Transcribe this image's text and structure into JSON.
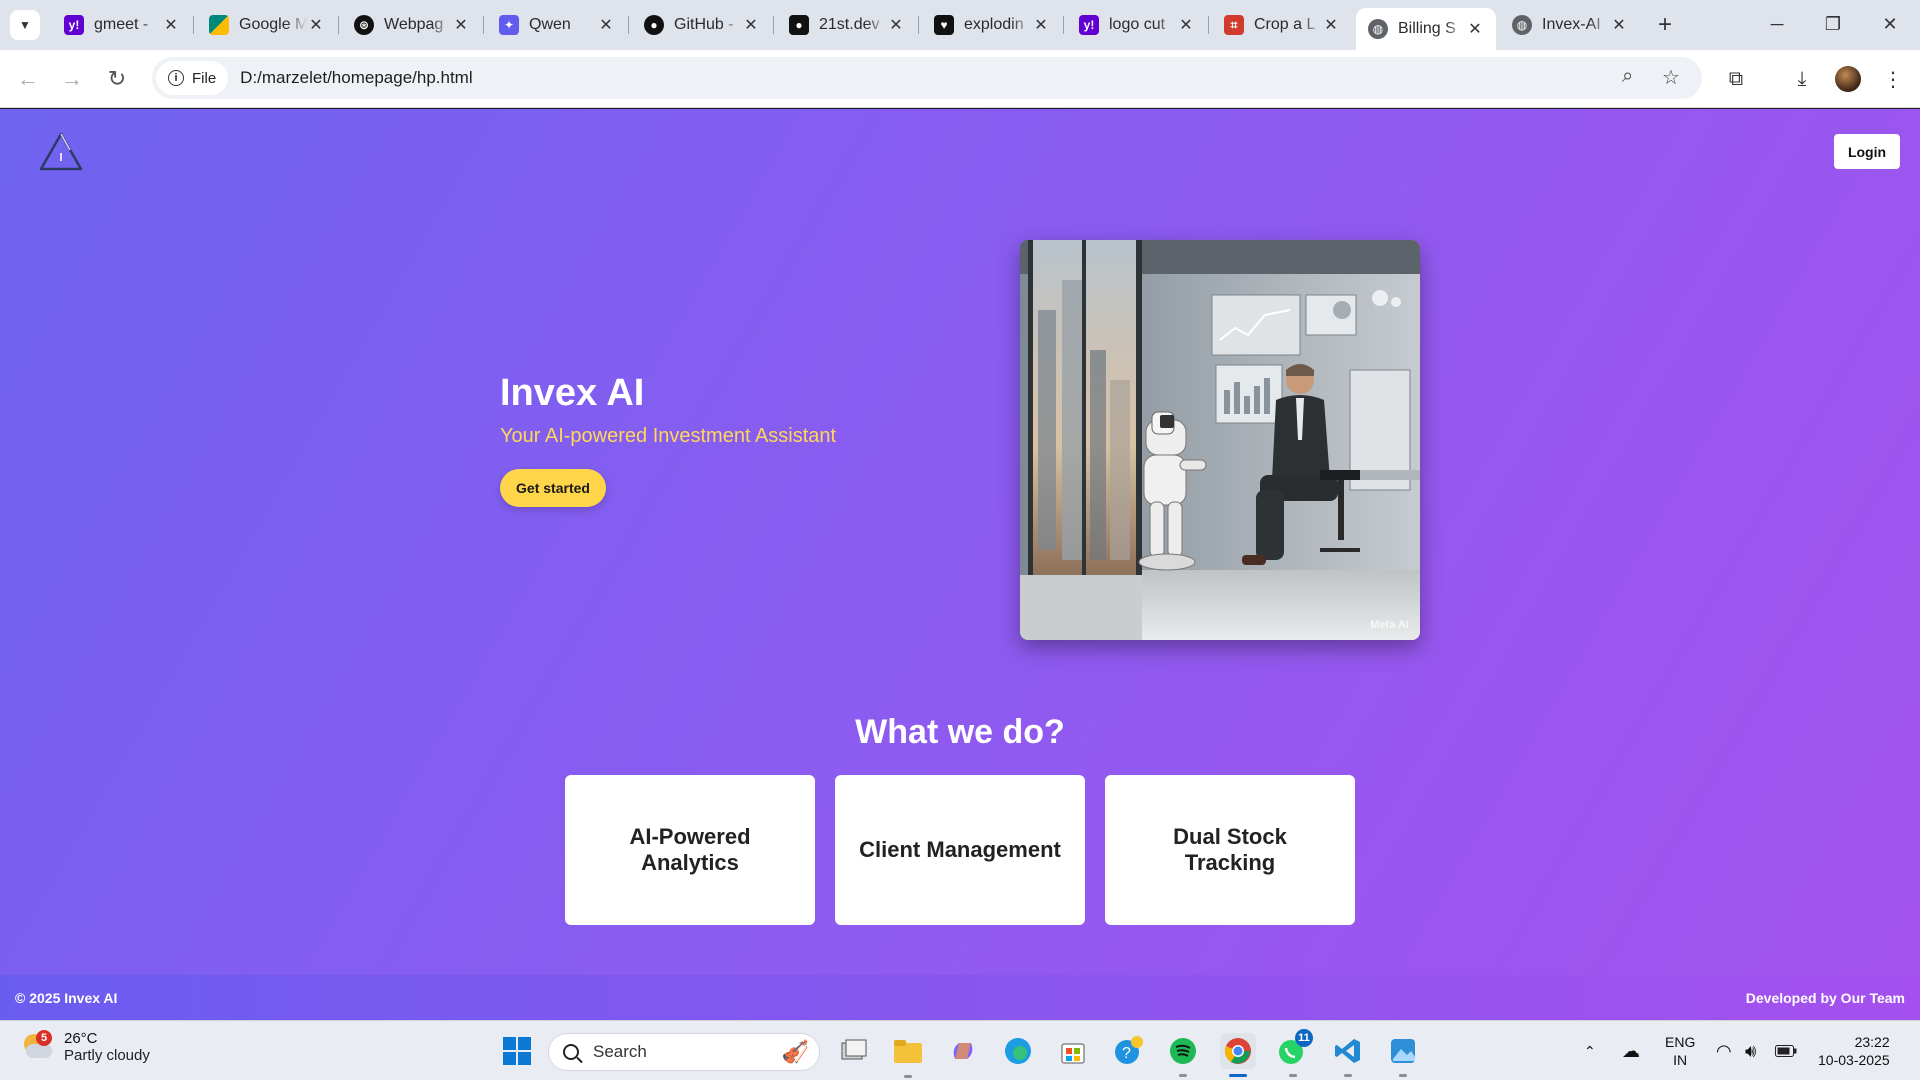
{
  "browser": {
    "tabs": [
      {
        "title": "gmeet -",
        "icon": "yahoo-icon",
        "color": "#6001d2"
      },
      {
        "title": "Google M",
        "icon": "google-meet-icon",
        "color": "#00897b"
      },
      {
        "title": "Webpag",
        "icon": "openai-icon",
        "color": "#111111"
      },
      {
        "title": "Qwen",
        "icon": "qwen-icon",
        "color": "#615ced"
      },
      {
        "title": "GitHub -",
        "icon": "github-icon",
        "color": "#111111"
      },
      {
        "title": "21st.dev",
        "icon": "21st-icon",
        "color": "#111111"
      },
      {
        "title": "explodin",
        "icon": "heart-icon",
        "color": "#111111"
      },
      {
        "title": "logo cut",
        "icon": "yahoo-icon",
        "color": "#6001d2"
      },
      {
        "title": "Crop a L",
        "icon": "crop-icon",
        "color": "#d23b2b"
      },
      {
        "title": "Billing S",
        "icon": "globe-icon",
        "color": "#5f6368",
        "active": true
      },
      {
        "title": "Invex-AI",
        "icon": "globe-icon",
        "color": "#5f6368"
      }
    ],
    "chip_label": "File",
    "url": "D:/marzelet/homepage/hp.html"
  },
  "page": {
    "login_label": "Login",
    "hero": {
      "title": "Invex AI",
      "subtitle": "Your AI-powered Investment Assistant",
      "cta_label": "Get started",
      "image_watermark": "Meta AI"
    },
    "section_title": "What we do?",
    "features": [
      "AI-Powered Analytics",
      "Client Management",
      "Dual Stock Tracking"
    ],
    "footer": {
      "copyright": "© 2025 Invex AI",
      "credit": "Developed by Our Team"
    },
    "colors": {
      "gradient_start": "#6f63ef",
      "gradient_end": "#a452ee",
      "accent_yellow": "#ffd54a"
    }
  },
  "taskbar": {
    "weather_temp": "26°C",
    "weather_condition": "Partly cloudy",
    "weather_badge": "5",
    "search_placeholder": "Search",
    "whatsapp_badge": "11",
    "language": "ENG",
    "region": "IN",
    "time": "23:22",
    "date": "10-03-2025"
  }
}
